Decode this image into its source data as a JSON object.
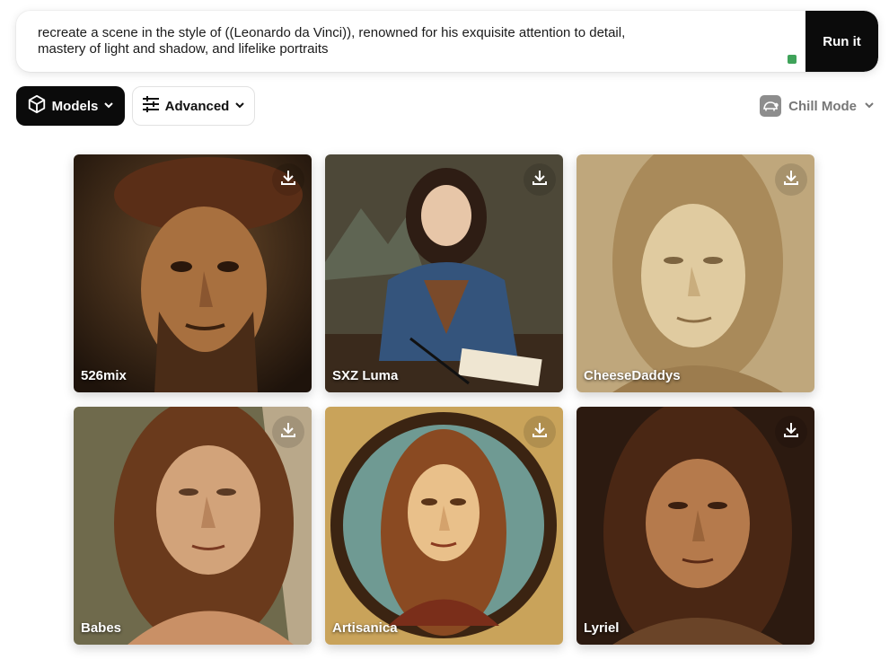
{
  "prompt": {
    "text_line1": "recreate a scene in the style of ((Leonardo da Vinci)), renowned for his exquisite attention to detail,",
    "text_line2": "mastery of light and shadow, and lifelike portraits",
    "run_label": "Run it",
    "status_color": "#3fa35a"
  },
  "toolbar": {
    "models_label": "Models",
    "advanced_label": "Advanced",
    "mode_label": "Chill Mode"
  },
  "gallery": {
    "items": [
      {
        "label": "526mix",
        "icon": "download-icon"
      },
      {
        "label": "SXZ Luma",
        "icon": "download-icon"
      },
      {
        "label": "CheeseDaddys",
        "icon": "download-icon"
      },
      {
        "label": "Babes",
        "icon": "download-icon"
      },
      {
        "label": "Artisanica",
        "icon": "download-icon"
      },
      {
        "label": "Lyriel",
        "icon": "download-icon"
      }
    ]
  },
  "colors": {
    "primary": "#0b0b0b",
    "muted": "#777777"
  }
}
